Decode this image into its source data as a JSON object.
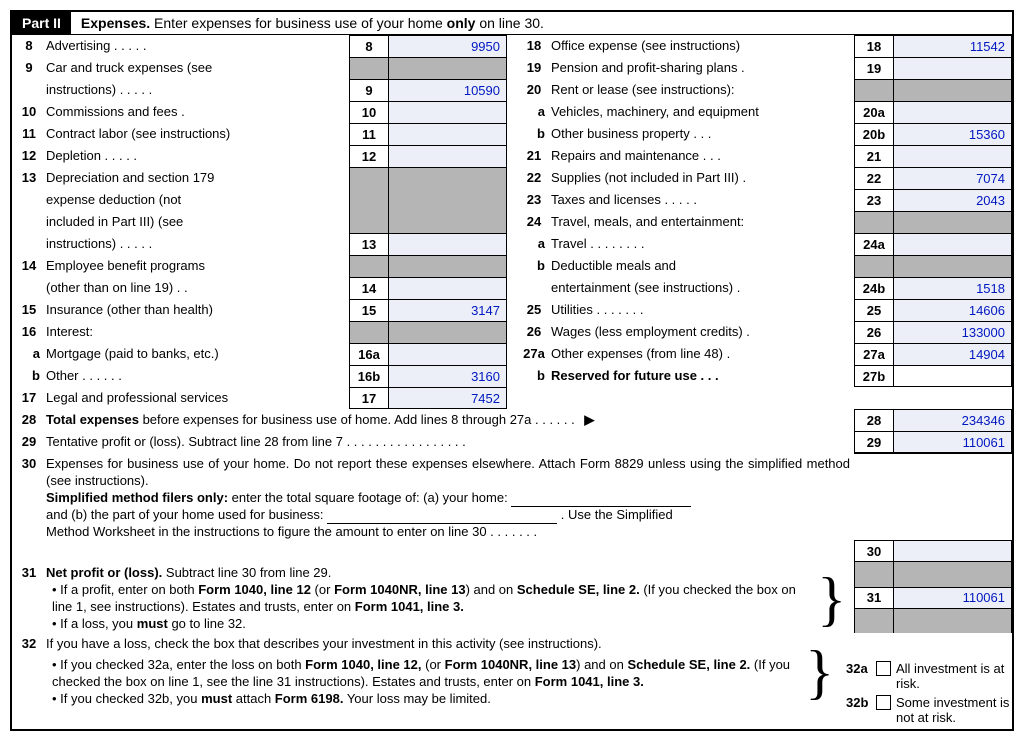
{
  "part": {
    "badge": "Part II",
    "title_a": "Expenses.",
    "title_b": " Enter expenses for business use of your home ",
    "title_c": "only",
    "title_d": " on line 30."
  },
  "left": {
    "l8": {
      "n": "8",
      "d": "Advertising .   .   .   .   .",
      "bn": "8",
      "v": "9950"
    },
    "l9": {
      "n": "9",
      "d1": "Car and truck expenses (see",
      "d2": "instructions) .   .   .   .   .",
      "bn": "9",
      "v": "10590"
    },
    "l10": {
      "n": "10",
      "d": "Commissions and fees    .",
      "bn": "10",
      "v": ""
    },
    "l11": {
      "n": "11",
      "d": "Contract labor (see instructions)",
      "bn": "11",
      "v": ""
    },
    "l12": {
      "n": "12",
      "d": "Depletion   .   .   .   .   .",
      "bn": "12",
      "v": ""
    },
    "l13": {
      "n": "13",
      "d1": "Depreciation and section 179",
      "d2": "expense deduction (not",
      "d3": "included in Part III) (see",
      "d4": "instructions) .   .   .   .   .",
      "bn": "13",
      "v": ""
    },
    "l14": {
      "n": "14",
      "d1": "Employee benefit programs",
      "d2": "(other than on line 19) .   .",
      "bn": "14",
      "v": ""
    },
    "l15": {
      "n": "15",
      "d": "Insurance (other than health)",
      "bn": "15",
      "v": "3147"
    },
    "l16": {
      "n": "16",
      "d": "Interest:"
    },
    "l16a": {
      "n": "a",
      "d": "Mortgage (paid to banks, etc.)",
      "bn": "16a",
      "v": ""
    },
    "l16b": {
      "n": "b",
      "d": "Other   .   .   .   .   .   .",
      "bn": "16b",
      "v": "3160"
    },
    "l17": {
      "n": "17",
      "d": "Legal and professional services",
      "bn": "17",
      "v": "7452"
    }
  },
  "right": {
    "l18": {
      "n": "18",
      "d": "Office expense (see instructions)",
      "bn": "18",
      "v": "11542"
    },
    "l19": {
      "n": "19",
      "d": "Pension and profit-sharing plans   .",
      "bn": "19",
      "v": ""
    },
    "l20": {
      "n": "20",
      "d": "Rent or lease (see instructions):"
    },
    "l20a": {
      "n": "a",
      "d": "Vehicles, machinery, and equipment",
      "bn": "20a",
      "v": ""
    },
    "l20b": {
      "n": "b",
      "d": "Other business property   .   .   .",
      "bn": "20b",
      "v": "15360"
    },
    "l21": {
      "n": "21",
      "d": "Repairs and maintenance .   .   .",
      "bn": "21",
      "v": ""
    },
    "l22": {
      "n": "22",
      "d": "Supplies (not included in Part III)   .",
      "bn": "22",
      "v": "7074"
    },
    "l23": {
      "n": "23",
      "d": "Taxes and licenses .   .   .   .   .",
      "bn": "23",
      "v": "2043"
    },
    "l24": {
      "n": "24",
      "d": "Travel, meals, and entertainment:"
    },
    "l24a": {
      "n": "a",
      "d": "Travel .   .   .   .   .   .   .   .",
      "bn": "24a",
      "v": ""
    },
    "l24b": {
      "n": "b",
      "d1": "Deductible meals and",
      "d2": "entertainment (see instructions)   .",
      "bn": "24b",
      "v": "1518"
    },
    "l25": {
      "n": "25",
      "d": "Utilities   .   .   .   .   .   .   .",
      "bn": "25",
      "v": "14606"
    },
    "l26": {
      "n": "26",
      "d": "Wages (less employment credits) .",
      "bn": "26",
      "v": "133000"
    },
    "l27a": {
      "n": "27a",
      "d": "Other expenses (from line 48)   .",
      "bn": "27a",
      "v": "14904"
    },
    "l27b": {
      "n": "b",
      "d": "Reserved for future use   .   .   .",
      "bn": "27b",
      "v": ""
    }
  },
  "bottom": {
    "l28": {
      "n": "28",
      "d": "Total expenses",
      "d2": " before expenses for business use of home. Add lines 8 through 27a   .   .   .   .   .   .  ",
      "bn": "28",
      "v": "234346"
    },
    "l29": {
      "n": "29",
      "d": "Tentative profit or (loss). Subtract line 28 from line 7   .   .   .   .   .   .   .   .   .   .   .   .   .   .   .   .   .",
      "bn": "29",
      "v": "110061"
    },
    "l30": {
      "n": "30",
      "p1": "Expenses for business use of your home. Do not report these expenses elsewhere. Attach Form 8829 unless using the simplified method (see instructions).",
      "p2a": "Simplified method filers only:",
      "p2b": " enter the total square footage of: (a) your home:",
      "p3a": "and (b) the part of your home used for business:",
      "p3b": ". Use the Simplified",
      "p4": "Method Worksheet in the instructions to figure the amount to enter on line 30    .    .    .    .    .    .    .",
      "bn": "30",
      "v": ""
    },
    "l31": {
      "n": "31",
      "h": "Net profit or (loss).",
      "h2": "  Subtract line 30 from line 29.",
      "b1a": "• If a profit, enter on both ",
      "b1b": "Form 1040, line 12",
      "b1c": " (or ",
      "b1d": "Form 1040NR, line 13",
      "b1e": ") and on ",
      "b1f": "Schedule SE, line 2.",
      "b1g": " (If you checked the box on line 1, see instructions). Estates and trusts, enter on ",
      "b1h": "Form 1041, line 3.",
      "b2a": "• If a loss, you ",
      "b2b": "must",
      "b2c": "  go to line 32.",
      "bn": "31",
      "v": "110061"
    },
    "l32": {
      "n": "32",
      "h": "If you have a loss, check the box that describes your investment in this activity (see instructions).",
      "b1a": "• If you checked 32a, enter the loss on both ",
      "b1b": "Form 1040, line 12,",
      "b1c": " (or ",
      "b1d": "Form 1040NR, line 13",
      "b1e": ") and on ",
      "b1f": "Schedule SE, line 2.",
      "b1g": " (If you checked the box on line 1, see the line 31 instructions). Estates and trusts, enter on ",
      "b1h": "Form 1041, line 3.",
      "b2a": "• If you checked 32b, you ",
      "b2b": "must",
      "b2c": " attach ",
      "b2d": "Form 6198.",
      "b2e": " Your loss may be limited.",
      "c32a_n": "32a",
      "c32a_l": "All investment is at risk.",
      "c32b_n": "32b",
      "c32b_l": "Some investment is not at risk."
    }
  }
}
